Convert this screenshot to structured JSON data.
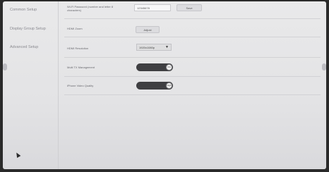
{
  "sidebar": {
    "items": [
      {
        "label": "Common Setup"
      },
      {
        "label": "Display Group Setup"
      },
      {
        "label": "Advanced Setup"
      }
    ]
  },
  "settings": {
    "wifi": {
      "label": "Wi-Fi Password (number and letter 8 characters)",
      "value": "12345678",
      "button": "Save"
    },
    "hdmi_zoom": {
      "label": "HDMI Zoom",
      "button": "Adjust"
    },
    "hdmi_resolution": {
      "label": "HDMI Resolution",
      "value": "1920x1080p",
      "caret": "▼"
    },
    "multi_tx": {
      "label": "Multi TX Management",
      "state": "On"
    },
    "iphone_video": {
      "label": "iPhone Video Quality",
      "state": "High"
    }
  }
}
